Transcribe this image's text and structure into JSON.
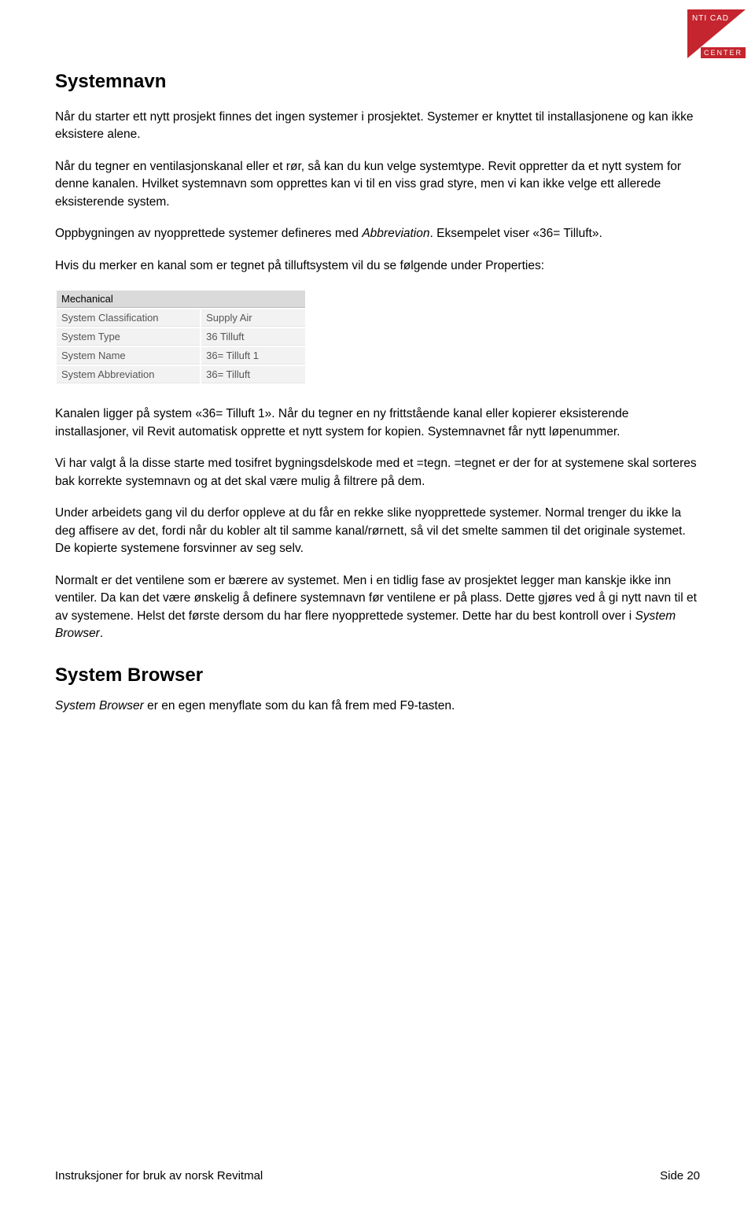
{
  "logo": {
    "line1": "NTI CAD",
    "line2": "CENTER"
  },
  "h1": "Systemnavn",
  "p1": "Når du starter ett nytt prosjekt finnes det ingen systemer i prosjektet. Systemer er knyttet til installasjonene og kan ikke eksistere alene.",
  "p2": "Når du tegner en ventilasjonskanal eller et rør, så kan du kun velge systemtype. Revit oppretter da et nytt system for denne kanalen. Hvilket systemnavn som opprettes kan vi til en viss grad styre, men vi kan ikke velge ett allerede eksisterende system.",
  "p3a": "Oppbygningen av nyopprettede systemer defineres med ",
  "p3b": "Abbreviation",
  "p3c": ". Eksempelet viser «36= Tilluft».",
  "p4": "Hvis du merker en kanal som er tegnet på tilluftsystem vil du se følgende under Properties:",
  "properties": {
    "header": "Mechanical",
    "rows": [
      {
        "k": "System Classification",
        "v": "Supply Air"
      },
      {
        "k": "System Type",
        "v": "36 Tilluft"
      },
      {
        "k": "System Name",
        "v": "36= Tilluft 1"
      },
      {
        "k": "System Abbreviation",
        "v": "36= Tilluft"
      }
    ]
  },
  "p5": "Kanalen ligger på system «36= Tilluft 1». Når du tegner en ny frittstående kanal eller kopierer eksisterende installasjoner, vil Revit automatisk opprette et nytt system for kopien. Systemnavnet får nytt løpenummer.",
  "p6": "Vi har valgt å la disse starte med tosifret bygningsdelskode med et =tegn. =tegnet er der for at systemene skal sorteres bak korrekte systemnavn og at det skal være mulig å filtrere på dem.",
  "p7": "Under arbeidets gang vil du derfor oppleve at du får en rekke slike nyopprettede systemer. Normal trenger du ikke la deg affisere av det, fordi når du kobler alt til samme kanal/rørnett, så vil det smelte sammen til det originale systemet. De kopierte systemene forsvinner av seg selv.",
  "p8a": "Normalt er det ventilene som er bærere av systemet. Men i en tidlig fase av prosjektet legger man kanskje ikke inn ventiler. Da kan det være ønskelig å definere systemnavn før ventilene er på plass. Dette gjøres ved å gi nytt navn til et av systemene. Helst det første dersom du har flere nyopprettede systemer. Dette har du best kontroll over i ",
  "p8b": "System Browser",
  "p8c": ".",
  "h2": "System Browser",
  "p9a": "System Browser",
  "p9b": " er en egen menyflate som du kan få frem med F9-tasten.",
  "footer": {
    "left": "Instruksjoner for bruk av norsk Revitmal",
    "right": "Side 20"
  }
}
